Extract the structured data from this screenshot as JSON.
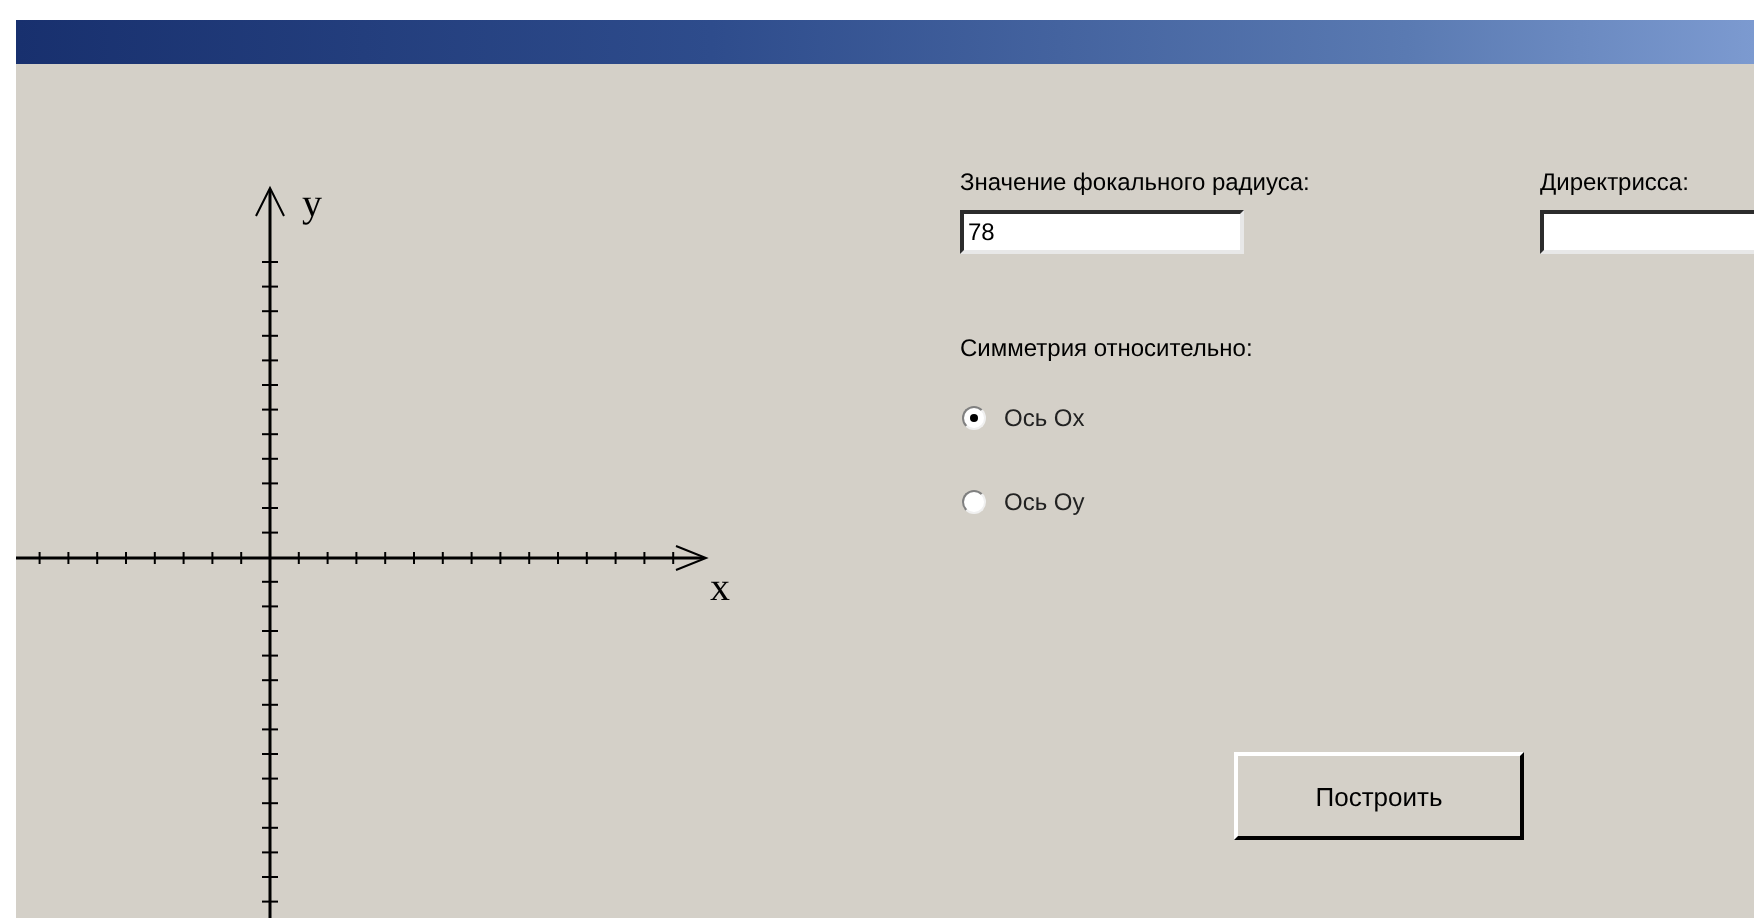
{
  "axes": {
    "x_label": "x",
    "y_label": "y"
  },
  "fields": [
    {
      "label": "Значение фокального радиуса:",
      "value": "78"
    },
    {
      "label": "Директрисса:"
    }
  ],
  "symmetry": {
    "label": "Симметрия относительно:",
    "options": [
      {
        "label": "Ось Ox",
        "selected": true
      },
      {
        "label": "Ось Oy",
        "selected": false
      }
    ]
  },
  "button": "Построить"
}
